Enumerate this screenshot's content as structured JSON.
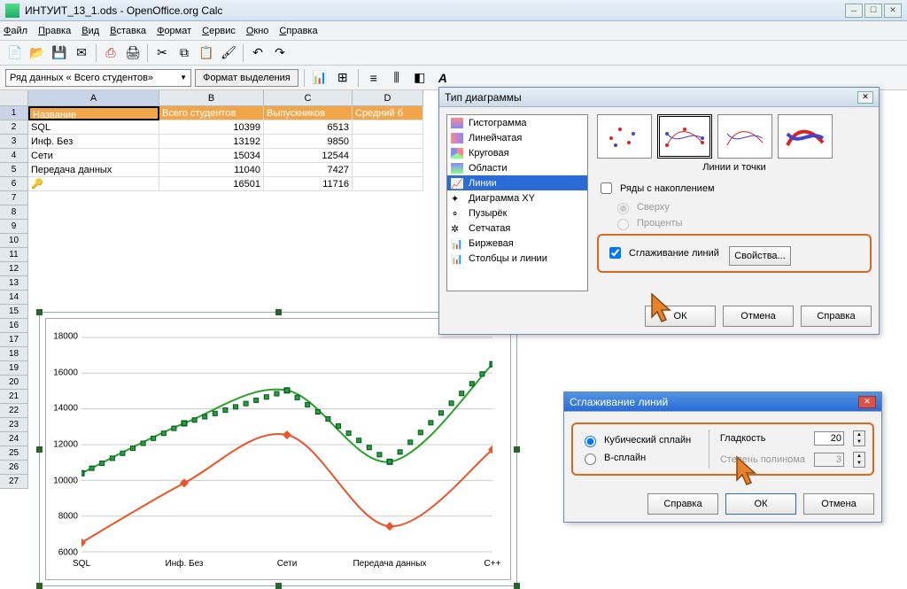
{
  "window": {
    "title": "ИНТУИТ_13_1.ods - OpenOffice.org Calc"
  },
  "menu": {
    "file": "Файл",
    "edit": "Правка",
    "view": "Вид",
    "insert": "Вставка",
    "format": "Формат",
    "service": "Сервис",
    "window": "Окно",
    "help": "Справка"
  },
  "seriesbar": {
    "combo": "Ряд данных « Всего студентов»",
    "button": "Формат выделения"
  },
  "columns": [
    "A",
    "B",
    "C",
    "D"
  ],
  "header_row": {
    "A": "Название",
    "B": "Всего студентов",
    "C": "Выпускников",
    "D": "Средний б"
  },
  "data_rows": [
    {
      "A": "SQL",
      "B": "10399",
      "C": "6513"
    },
    {
      "A": "Инф. Без",
      "B": "13192",
      "C": "9850"
    },
    {
      "A": "Сети",
      "B": "15034",
      "C": "12544"
    },
    {
      "A": "Передача данных",
      "B": "11040",
      "C": "7427"
    },
    {
      "A": "",
      "B": "16501",
      "C": "11716"
    }
  ],
  "chart_data": {
    "type": "line",
    "categories": [
      "SQL",
      "Инф. Без",
      "Сети",
      "Передача данных",
      "C++"
    ],
    "series": [
      {
        "name": "Всего студентов",
        "values": [
          10399,
          13192,
          15034,
          11040,
          16501
        ],
        "color": "#2aa02a"
      },
      {
        "name": "Выпускников",
        "values": [
          6513,
          9850,
          12544,
          7427,
          11716
        ],
        "color": "#e8552a"
      }
    ],
    "yticks": [
      6000,
      8000,
      10000,
      12000,
      14000,
      16000,
      18000
    ],
    "ylim": [
      6000,
      18000
    ]
  },
  "dlg1": {
    "title": "Тип диаграммы",
    "types": [
      "Гистограмма",
      "Линейчатая",
      "Круговая",
      "Области",
      "Линии",
      "Диаграмма XY",
      "Пузырёк",
      "Сетчатая",
      "Биржевая",
      "Столбцы и линии"
    ],
    "subtype_caption": "Линии и точки",
    "stacked": "Ряды с накоплением",
    "on_top": "Сверху",
    "percent": "Проценты",
    "smooth": "Сглаживание линий",
    "props": "Свойства...",
    "ok": "ОК",
    "cancel": "Отмена",
    "help": "Справка"
  },
  "dlg2": {
    "title": "Сглаживание линий",
    "cubic": "Кубический сплайн",
    "bspline": "В-сплайн",
    "smoothness": "Гладкость",
    "smoothness_val": "20",
    "degree": "Степень полинома",
    "degree_val": "3",
    "help": "Справка",
    "ok": "ОК",
    "cancel": "Отмена"
  }
}
